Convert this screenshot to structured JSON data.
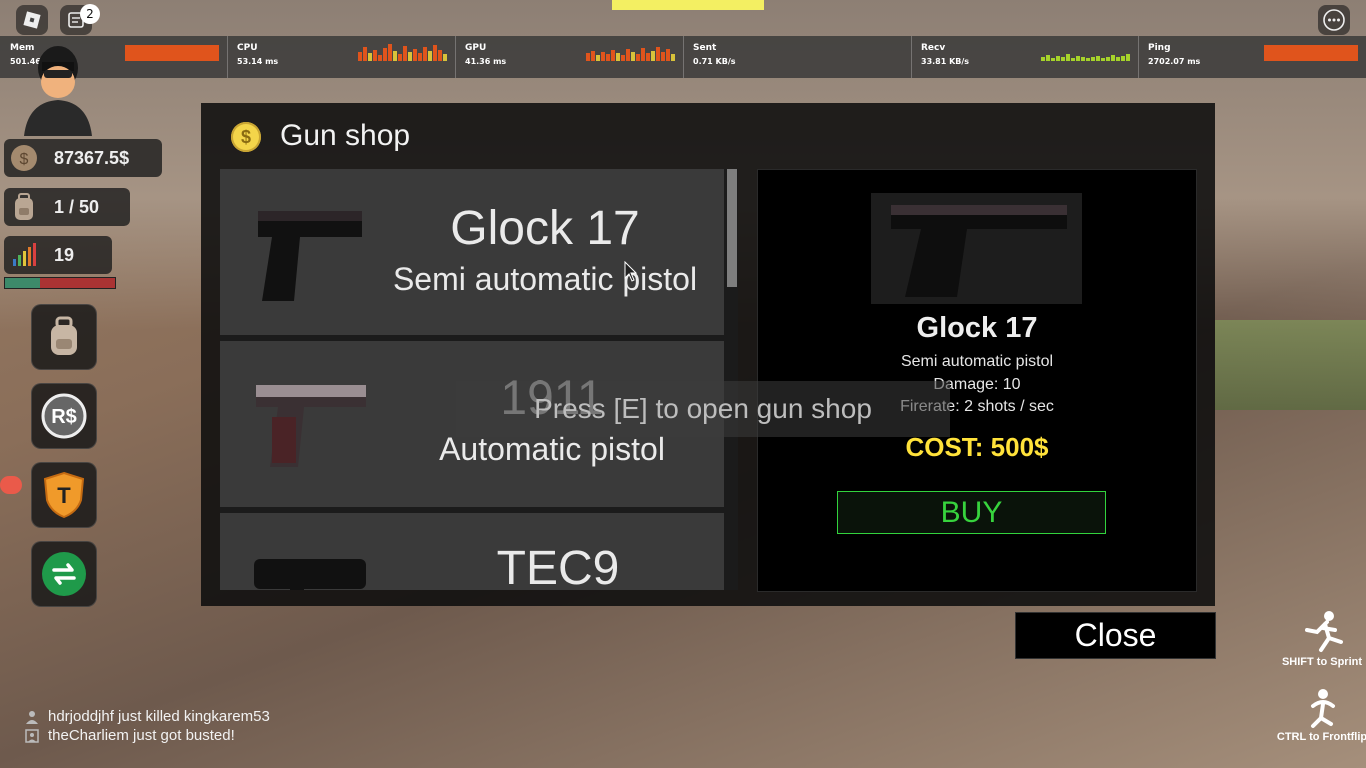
{
  "topbar": {
    "chat_badge": "2"
  },
  "stats": [
    {
      "label": "Mem",
      "value": "501.46 MB"
    },
    {
      "label": "CPU",
      "value": "53.14 ms"
    },
    {
      "label": "GPU",
      "value": "41.36 ms"
    },
    {
      "label": "Sent",
      "value": "0.71 KB/s"
    },
    {
      "label": "Recv",
      "value": "33.81 KB/s"
    },
    {
      "label": "Ping",
      "value": "2702.07 ms"
    }
  ],
  "hud": {
    "money": "87367.5$",
    "inventory": "1 / 50",
    "level": "19",
    "level_progress": 0.32
  },
  "shop": {
    "title": "Gun shop",
    "items": [
      {
        "name": "Glock 17",
        "description": "Semi automatic pistol"
      },
      {
        "name": "1911",
        "description": "Automatic pistol"
      },
      {
        "name": "TEC9",
        "description": ""
      }
    ],
    "selected": {
      "name": "Glock 17",
      "description": "Semi automatic pistol",
      "damage": "Damage: 10",
      "firerate": "Firerate: 2 shots / sec",
      "cost": "COST: 500$",
      "buy_label": "BUY"
    },
    "close_label": "Close"
  },
  "prompt": "Press [E] to open gun shop",
  "hints": {
    "sprint": "SHIFT to Sprint",
    "frontflip": "CTRL to Frontflip"
  },
  "feed": [
    "hdrjoddjhf just killed kingkarem53",
    "theCharliem just got busted!"
  ],
  "colors": {
    "accent_yellow": "#ffe23a",
    "buy_green": "#37d33d",
    "graph_orange": "#e0541c"
  }
}
